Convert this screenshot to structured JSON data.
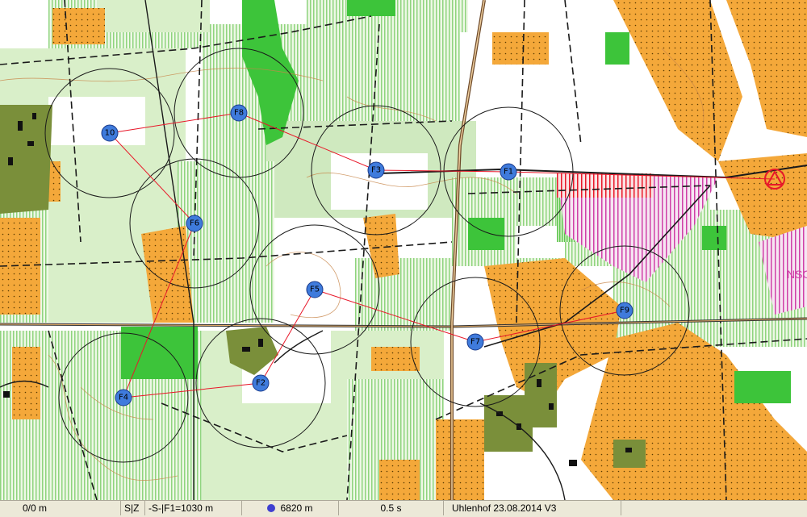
{
  "map": {
    "colors": {
      "open": "#f4a83a",
      "forest_light": "#d9efc9",
      "forest_green": "#3dc43a",
      "building": "#7a8f3a",
      "course": "#e8182a",
      "control_fill": "#3f7bdc",
      "restricted": "#d040a8"
    },
    "start_label": "start-triangle",
    "controls": [
      {
        "id": "f1",
        "label": "F1"
      },
      {
        "id": "f2",
        "label": "F2"
      },
      {
        "id": "f3",
        "label": "F3"
      },
      {
        "id": "f4",
        "label": "F4"
      },
      {
        "id": "f5",
        "label": "F5"
      },
      {
        "id": "f6",
        "label": "F6"
      },
      {
        "id": "f7",
        "label": "F7"
      },
      {
        "id": "f8",
        "label": "F8"
      },
      {
        "id": "f9",
        "label": "F9"
      },
      {
        "id": "c10",
        "label": "10"
      }
    ],
    "partial_text": "NSO"
  },
  "status_bar": {
    "distance": "0/0 m",
    "sz": "S|Z",
    "leg": "-S-|F1=1030 m",
    "total": "6820 m",
    "total_dot_color": "#3f3fd0",
    "time": "0.5 s",
    "event": "Uhlenhof 23.08.2014 V3"
  }
}
